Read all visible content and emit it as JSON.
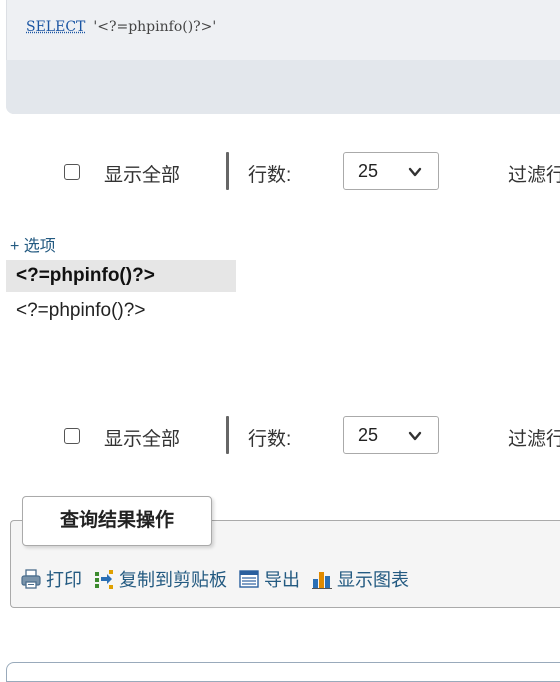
{
  "sql": {
    "keyword": "SELECT",
    "literal": "'<?=phpinfo()?>'"
  },
  "nav": {
    "show_all": "显示全部",
    "rows_label": "行数:",
    "rows_value": "25",
    "filter_label": "过滤行"
  },
  "options": {
    "label": "+ 选项"
  },
  "results": {
    "column_header": "<?=phpinfo()?>",
    "cell_value": "<?=phpinfo()?>"
  },
  "query_ops": {
    "title": "查询结果操作",
    "actions": [
      {
        "label": "打印",
        "icon": "print-icon"
      },
      {
        "label": "复制到剪贴板",
        "icon": "clipboard-icon"
      },
      {
        "label": "导出",
        "icon": "export-icon"
      },
      {
        "label": "显示图表",
        "icon": "chart-icon"
      }
    ]
  }
}
